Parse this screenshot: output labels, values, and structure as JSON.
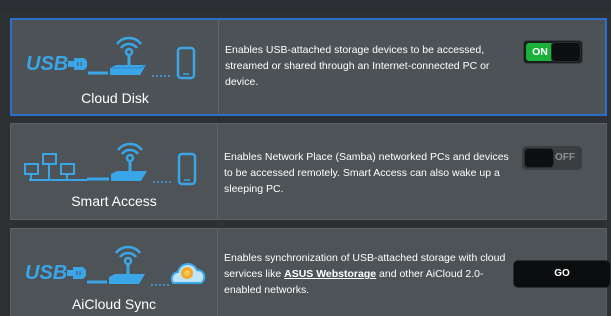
{
  "features": [
    {
      "title": "Cloud Disk",
      "description": "Enables USB-attached storage devices to be accessed, streamed or shared through an Internet-connected PC or device.",
      "control": {
        "type": "toggle",
        "state": "on",
        "label": "ON"
      },
      "icons": [
        "usb-icon",
        "router-icon",
        "phone-icon"
      ]
    },
    {
      "title": "Smart Access",
      "description": "Enables Network Place (Samba) networked PCs and devices to be accessed remotely. Smart Access can also wake up a sleeping PC.",
      "control": {
        "type": "toggle",
        "state": "off",
        "label": "OFF"
      },
      "icons": [
        "network-pcs-icon",
        "router-icon",
        "phone-icon"
      ]
    },
    {
      "title": "AiCloud Sync",
      "description_before": "Enables synchronization of USB-attached storage with cloud services like ",
      "description_link": "ASUS Webstorage",
      "description_after": " and other AiCloud 2.0-enabled networks.",
      "control": {
        "type": "button",
        "label": "GO"
      },
      "icons": [
        "usb-icon",
        "router-icon",
        "cloud-icon"
      ]
    }
  ],
  "colors": {
    "accent_selected_border": "#2a6fc9",
    "toggle_on": "#19b13a",
    "icon_blue": "#3aa6e8",
    "card_background": "#4d5356",
    "page_background": "#2d3134"
  }
}
